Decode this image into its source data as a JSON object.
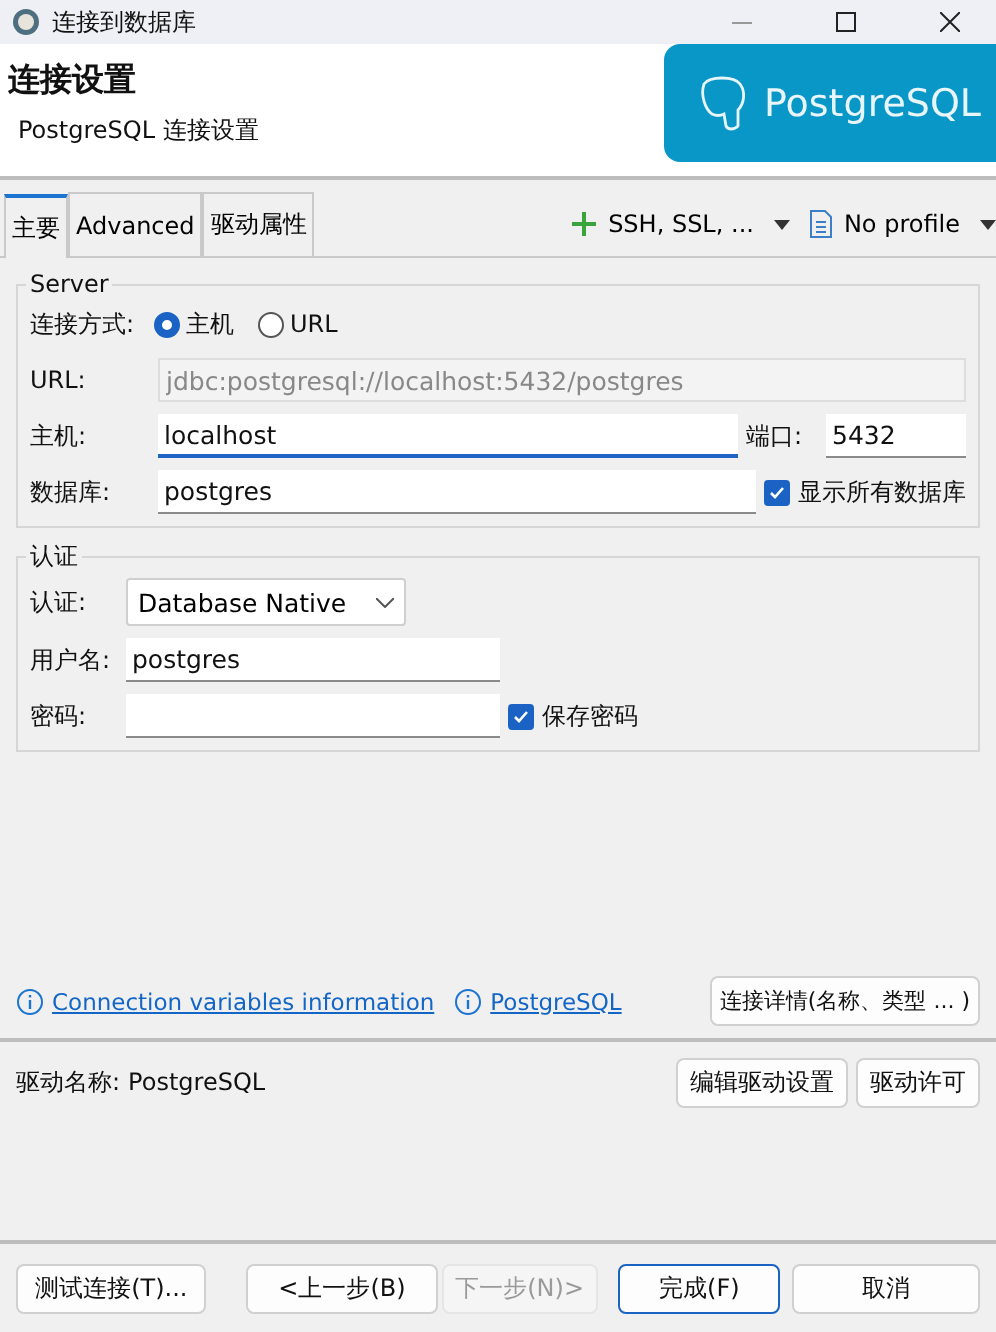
{
  "window": {
    "title": "连接到数据库"
  },
  "header": {
    "title": "连接设置",
    "subtitle": "PostgreSQL 连接设置",
    "logo_text": "PostgreSQL"
  },
  "tabs": [
    {
      "label": "主要",
      "selected": true
    },
    {
      "label": "Advanced",
      "selected": false
    },
    {
      "label": "驱动属性",
      "selected": false
    }
  ],
  "toolbar": [
    {
      "kind": "plus",
      "label": "SSH, SSL, ..."
    },
    {
      "kind": "document",
      "label": "No profile"
    }
  ],
  "server": {
    "legend": "Server",
    "mode_label": "连接方式:",
    "modes": [
      {
        "label": "主机",
        "selected": true
      },
      {
        "label": "URL",
        "selected": false
      }
    ],
    "url_label": "URL:",
    "url_value": "jdbc:postgresql://localhost:5432/postgres",
    "host_label": "主机:",
    "host_value": "localhost",
    "port_label": "端口:",
    "port_value": "5432",
    "db_label": "数据库:",
    "db_value": "postgres",
    "show_all": {
      "label": "显示所有数据库",
      "checked": true
    }
  },
  "auth": {
    "legend": "认证",
    "auth_label": "认证:",
    "auth_value": "Database Native",
    "user_label": "用户名:",
    "user_value": "postgres",
    "pass_label": "密码:",
    "save_password": {
      "label": "保存密码",
      "checked": true
    }
  },
  "links": [
    {
      "label": "Connection variables information"
    },
    {
      "label": "PostgreSQL"
    }
  ],
  "details_button": "连接详情(名称、类型 ... )",
  "driver": {
    "label": "驱动名称:",
    "value": "PostgreSQL",
    "buttons": [
      "编辑驱动设置",
      "驱动许可"
    ]
  },
  "footer_buttons": [
    {
      "label": "测试连接(T)...",
      "kind": "normal",
      "disabled": false
    },
    {
      "label": "<上一步(B)",
      "kind": "normal",
      "disabled": false
    },
    {
      "label": "下一步(N)>",
      "kind": "normal",
      "disabled": true
    },
    {
      "label": "完成(F)",
      "kind": "default",
      "disabled": false
    },
    {
      "label": "取消",
      "kind": "normal",
      "disabled": false
    }
  ]
}
